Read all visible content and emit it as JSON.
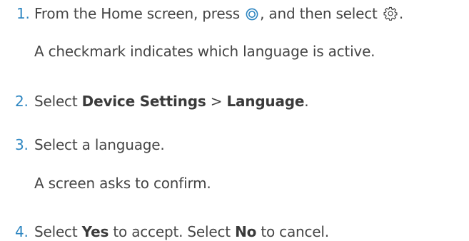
{
  "steps": [
    {
      "number": "1.",
      "text_a": "From the Home screen, press",
      "text_b": ", and then select",
      "text_c": ".",
      "note": "A checkmark indicates which language is active."
    },
    {
      "number": "2.",
      "text_a": "Select",
      "bold_a": "Device Settings",
      "text_b": ">",
      "bold_b": "Language",
      "text_c": "."
    },
    {
      "number": "3.",
      "text_a": "Select a language.",
      "note": "A screen asks to confirm."
    },
    {
      "number": "4.",
      "text_a": "Select",
      "bold_a": "Yes",
      "text_b": "to accept. Select",
      "bold_b": "No",
      "text_c": "to cancel."
    }
  ],
  "icons": {
    "button": "menu-button-icon",
    "settings": "gear-icon"
  }
}
